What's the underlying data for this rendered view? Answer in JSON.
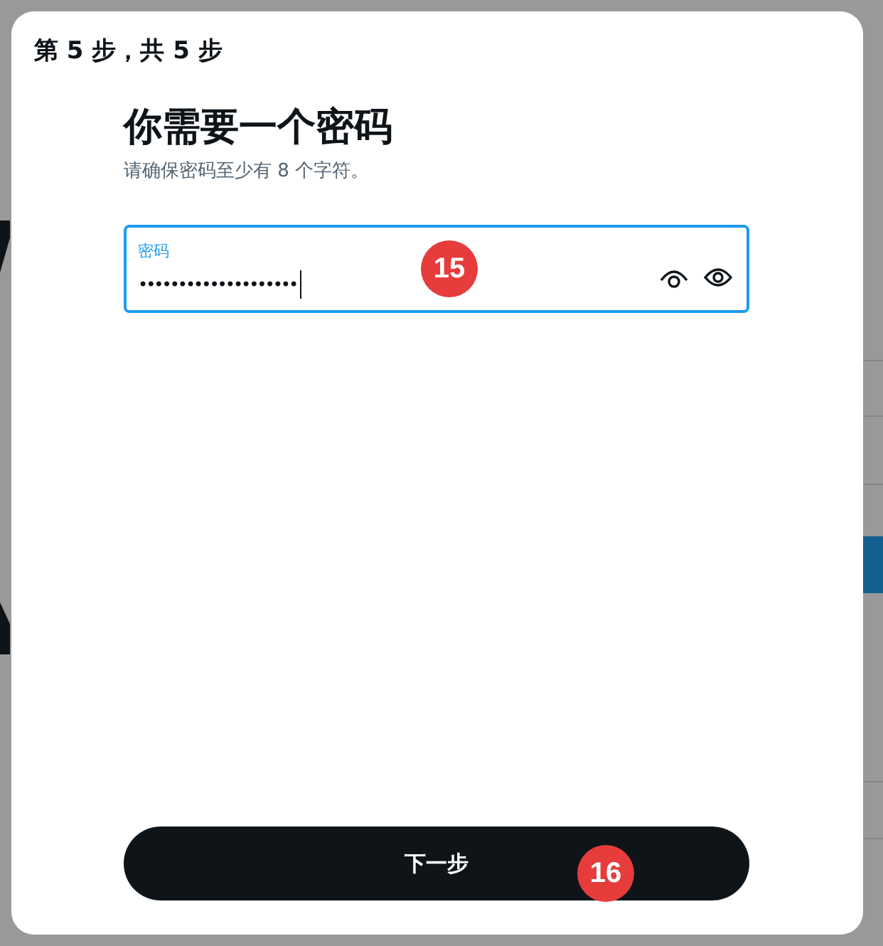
{
  "dialog": {
    "step": "第 5 步，共 5 步",
    "title": "你需要一个密码",
    "subtitle": "请确保密码至少有 8 个字符。",
    "password_field": {
      "label": "密码",
      "value": "••••••••••••••••••••",
      "focused": true
    },
    "next_button": {
      "label": "下一步"
    }
  },
  "markers": [
    {
      "label": "15"
    },
    {
      "label": "16"
    }
  ]
}
